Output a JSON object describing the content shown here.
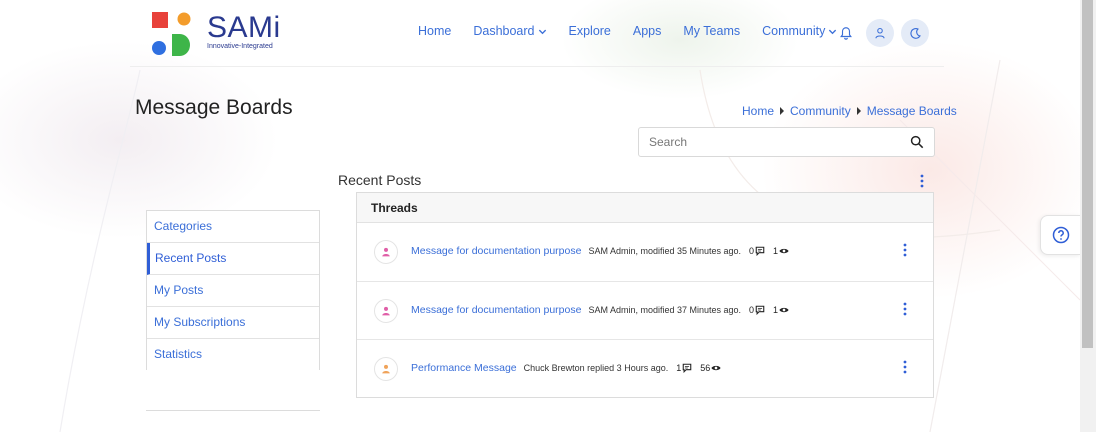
{
  "brand": {
    "name": "SAMi",
    "tagline": "Innovative-Integrated",
    "colors": {
      "orange": "#f39c2b",
      "red": "#e8413a",
      "blue": "#2f6fe0",
      "green": "#3eb549",
      "text": "#2a3a8f"
    }
  },
  "nav": {
    "home": "Home",
    "dashboard": "Dashboard",
    "explore": "Explore",
    "apps": "Apps",
    "my_teams": "My Teams",
    "community": "Community",
    "icons": [
      "bell-icon",
      "user-icon",
      "moon-icon",
      "chevron-down-icon"
    ]
  },
  "page": {
    "title": "Message Boards",
    "breadcrumb": [
      "Home",
      "Community",
      "Message Boards"
    ]
  },
  "search": {
    "placeholder": "Search"
  },
  "section": {
    "title": "Recent Posts"
  },
  "sidebar": {
    "items": [
      {
        "label": "Categories"
      },
      {
        "label": "Recent Posts"
      },
      {
        "label": "My Posts"
      },
      {
        "label": "My Subscriptions"
      },
      {
        "label": "Statistics"
      }
    ],
    "active": "Recent Posts"
  },
  "threads": {
    "header": "Threads",
    "rows": [
      {
        "title": "Message for documentation purpose",
        "meta": "SAM Admin, modified 35 Minutes ago.",
        "replies": "0",
        "views": "1",
        "avatar_color": "#e05fa8"
      },
      {
        "title": "Message for documentation purpose",
        "meta": "SAM Admin, modified 37 Minutes ago.",
        "replies": "0",
        "views": "1",
        "avatar_color": "#e05fa8"
      },
      {
        "title": "Performance Message",
        "meta": "Chuck Brewton replied 3 Hours ago.",
        "replies": "1",
        "views": "56",
        "avatar_color": "#f0a35a"
      }
    ]
  },
  "accent": "#3b6fd8"
}
